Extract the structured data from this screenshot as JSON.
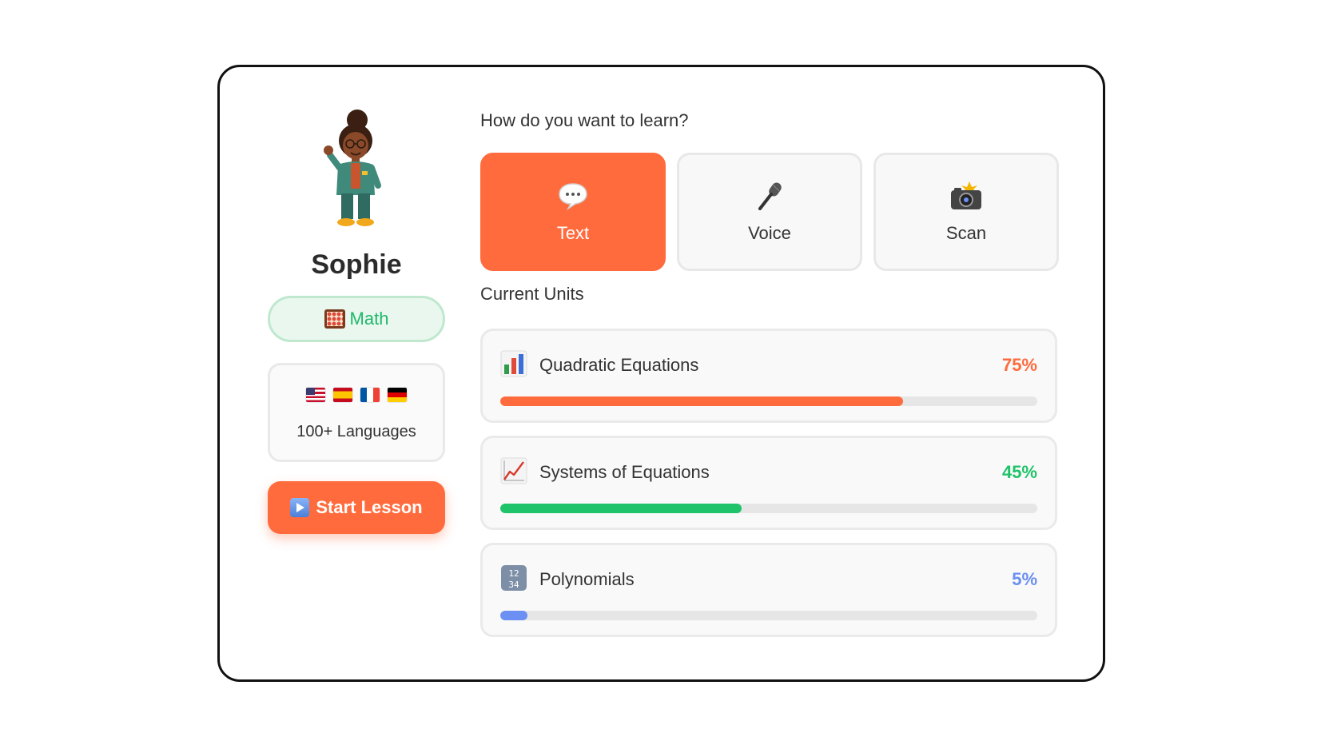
{
  "profile": {
    "name": "Sophie",
    "subject": "Math",
    "languages_label": "100+ Languages",
    "flags": [
      "us-flag",
      "es-flag",
      "fr-flag",
      "de-flag"
    ],
    "start_button": "Start Lesson"
  },
  "learn_mode": {
    "title": "How do you want to learn?",
    "options": [
      {
        "label": "Text",
        "icon": "speech-bubble-icon",
        "selected": true
      },
      {
        "label": "Voice",
        "icon": "microphone-icon",
        "selected": false
      },
      {
        "label": "Scan",
        "icon": "camera-flash-icon",
        "selected": false
      }
    ]
  },
  "units": {
    "title": "Current Units",
    "items": [
      {
        "title": "Quadratic Equations",
        "percent_label": "75%",
        "progress": 0.75,
        "color": "#ff6b3d",
        "icon": "bar-chart-icon"
      },
      {
        "title": "Systems of Equations",
        "percent_label": "45%",
        "progress": 0.45,
        "color": "#1fc46a",
        "icon": "line-chart-icon"
      },
      {
        "title": "Polynomials",
        "percent_label": "5%",
        "progress": 0.05,
        "color": "#6b8ff2",
        "icon": "numbers-icon"
      }
    ]
  },
  "colors": {
    "accent": "#ff6b3d",
    "success": "#1fc46a",
    "info": "#6b8ff2"
  }
}
